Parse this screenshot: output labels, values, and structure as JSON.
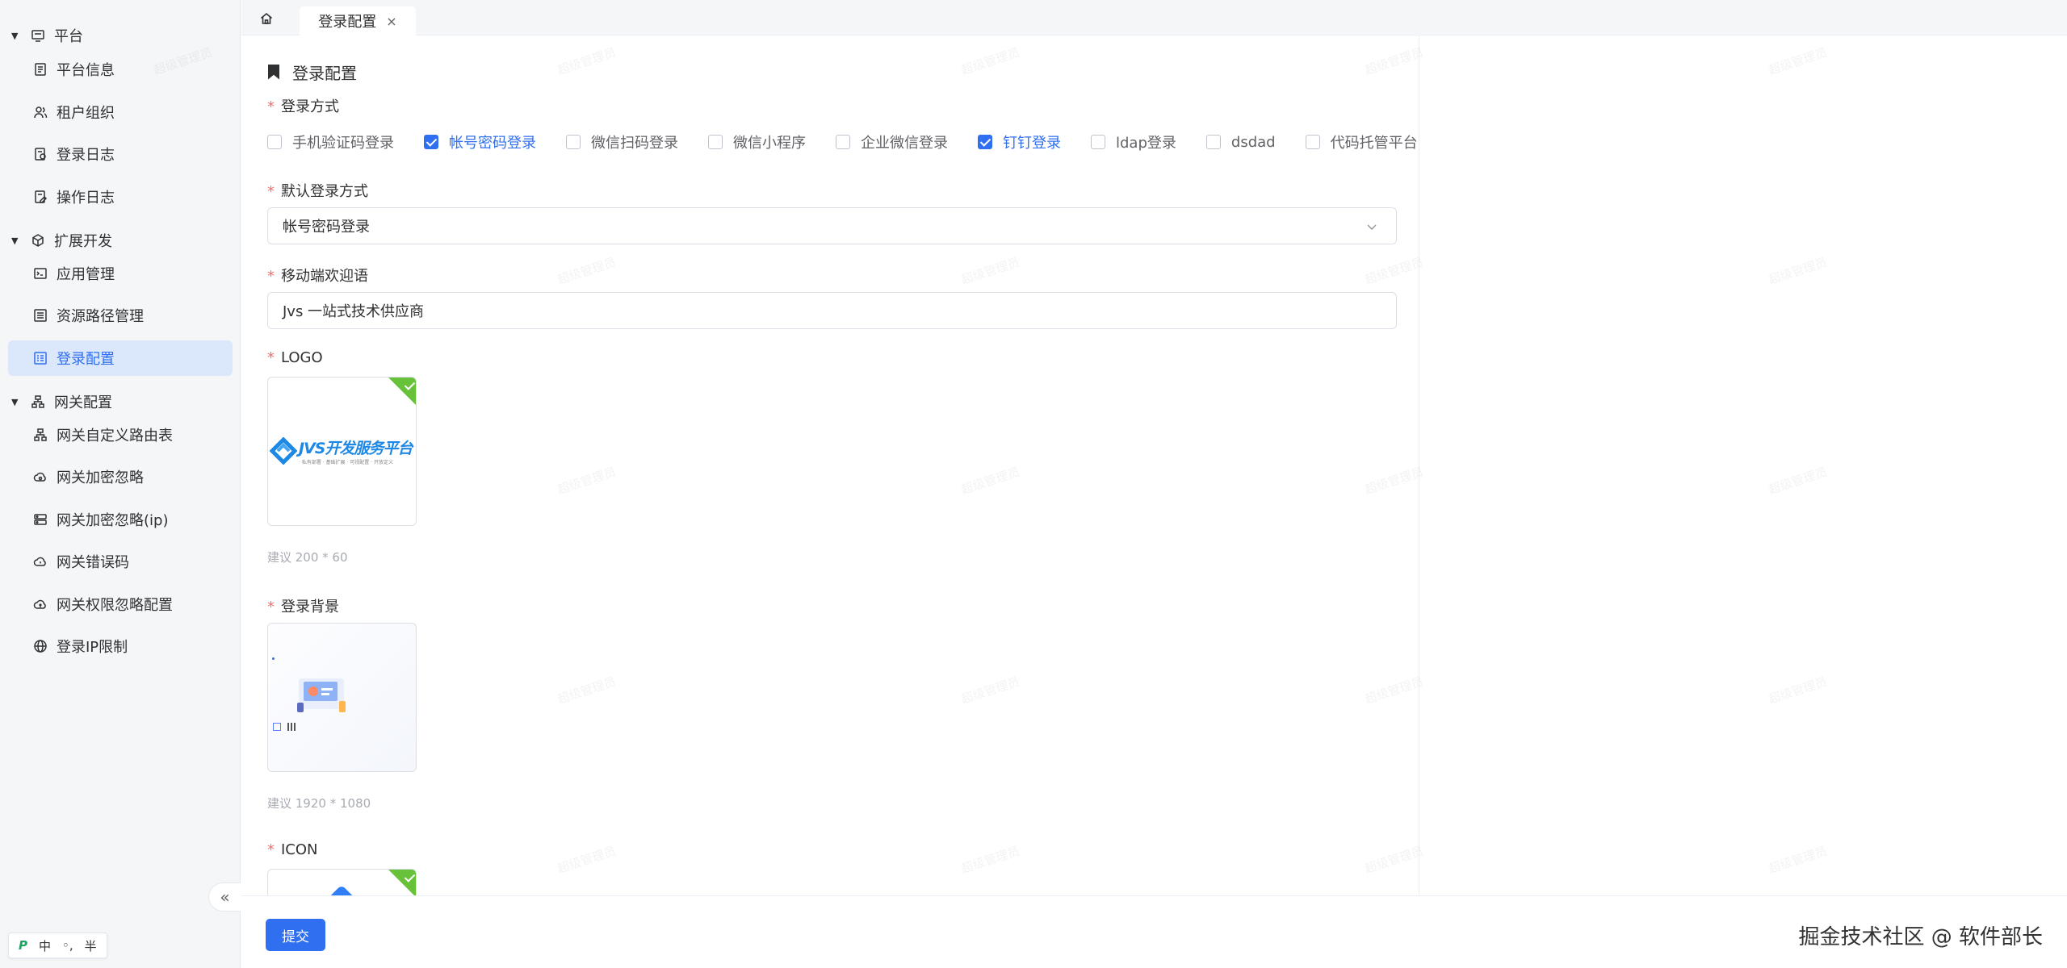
{
  "sidebar": {
    "groups": [
      {
        "label": "平台",
        "icon": "monitor-icon"
      },
      {
        "label": "扩展开发",
        "icon": "cube-icon"
      },
      {
        "label": "网关配置",
        "icon": "network-icon"
      }
    ],
    "items": [
      {
        "label": "平台信息",
        "icon": "document-icon",
        "active": false
      },
      {
        "label": "租户组织",
        "icon": "users-icon",
        "active": false
      },
      {
        "label": "登录日志",
        "icon": "log-icon",
        "active": false
      },
      {
        "label": "操作日志",
        "icon": "edit-log-icon",
        "active": false
      },
      {
        "label": "应用管理",
        "icon": "terminal-icon",
        "active": false
      },
      {
        "label": "资源路径管理",
        "icon": "list-icon",
        "active": false
      },
      {
        "label": "登录配置",
        "icon": "settings-list-icon",
        "active": true
      },
      {
        "label": "网关自定义路由表",
        "icon": "route-icon",
        "active": false
      },
      {
        "label": "网关加密忽略",
        "icon": "cloud-icon",
        "active": false
      },
      {
        "label": "网关加密忽略(ip)",
        "icon": "server-icon",
        "active": false
      },
      {
        "label": "网关错误码",
        "icon": "cloud-error-icon",
        "active": false
      },
      {
        "label": "网关权限忽略配置",
        "icon": "cloud-upload-icon",
        "active": false
      },
      {
        "label": "登录IP限制",
        "icon": "globe-icon",
        "active": false
      }
    ],
    "collapse_label": "«",
    "ime": {
      "logo": "P",
      "lang": "中",
      "punct": "◦,",
      "width": "半"
    }
  },
  "tabs": {
    "home_icon": "home-icon",
    "active_tab": "登录配置",
    "close_glyph": "×"
  },
  "form": {
    "section_title": "登录配置",
    "login_methods_label": "登录方式",
    "login_methods": [
      {
        "label": "手机验证码登录",
        "checked": false
      },
      {
        "label": "帐号密码登录",
        "checked": true
      },
      {
        "label": "微信扫码登录",
        "checked": false
      },
      {
        "label": "微信小程序",
        "checked": false
      },
      {
        "label": "企业微信登录",
        "checked": false
      },
      {
        "label": "钉钉登录",
        "checked": true
      },
      {
        "label": "ldap登录",
        "checked": false
      },
      {
        "label": "dsdad",
        "checked": false
      },
      {
        "label": "代码托管平台",
        "checked": false
      }
    ],
    "default_method_label": "默认登录方式",
    "default_method_value": "帐号密码登录",
    "welcome_label": "移动端欢迎语",
    "welcome_value": "Jvs 一站式技术供应商",
    "logo_label": "LOGO",
    "logo_text": "JVS开发服务平台",
    "logo_subtext": "· 私有部署 · 基础扩展 · 可视配置 · 开放定义",
    "logo_hint": "建议 200 * 60",
    "bg_label": "登录背景",
    "bg_hint": "建议 1920 * 1080",
    "icon_label": "ICON",
    "required_mark": "*"
  },
  "footer": {
    "submit_label": "提交",
    "credit": "掘金技术社区 @ 软件部长"
  },
  "watermark_text": "超级管理员",
  "colors": {
    "primary": "#2f6ff0",
    "success": "#67c23a",
    "required": "#f56c6c",
    "active_bg": "#dbe7fb"
  }
}
